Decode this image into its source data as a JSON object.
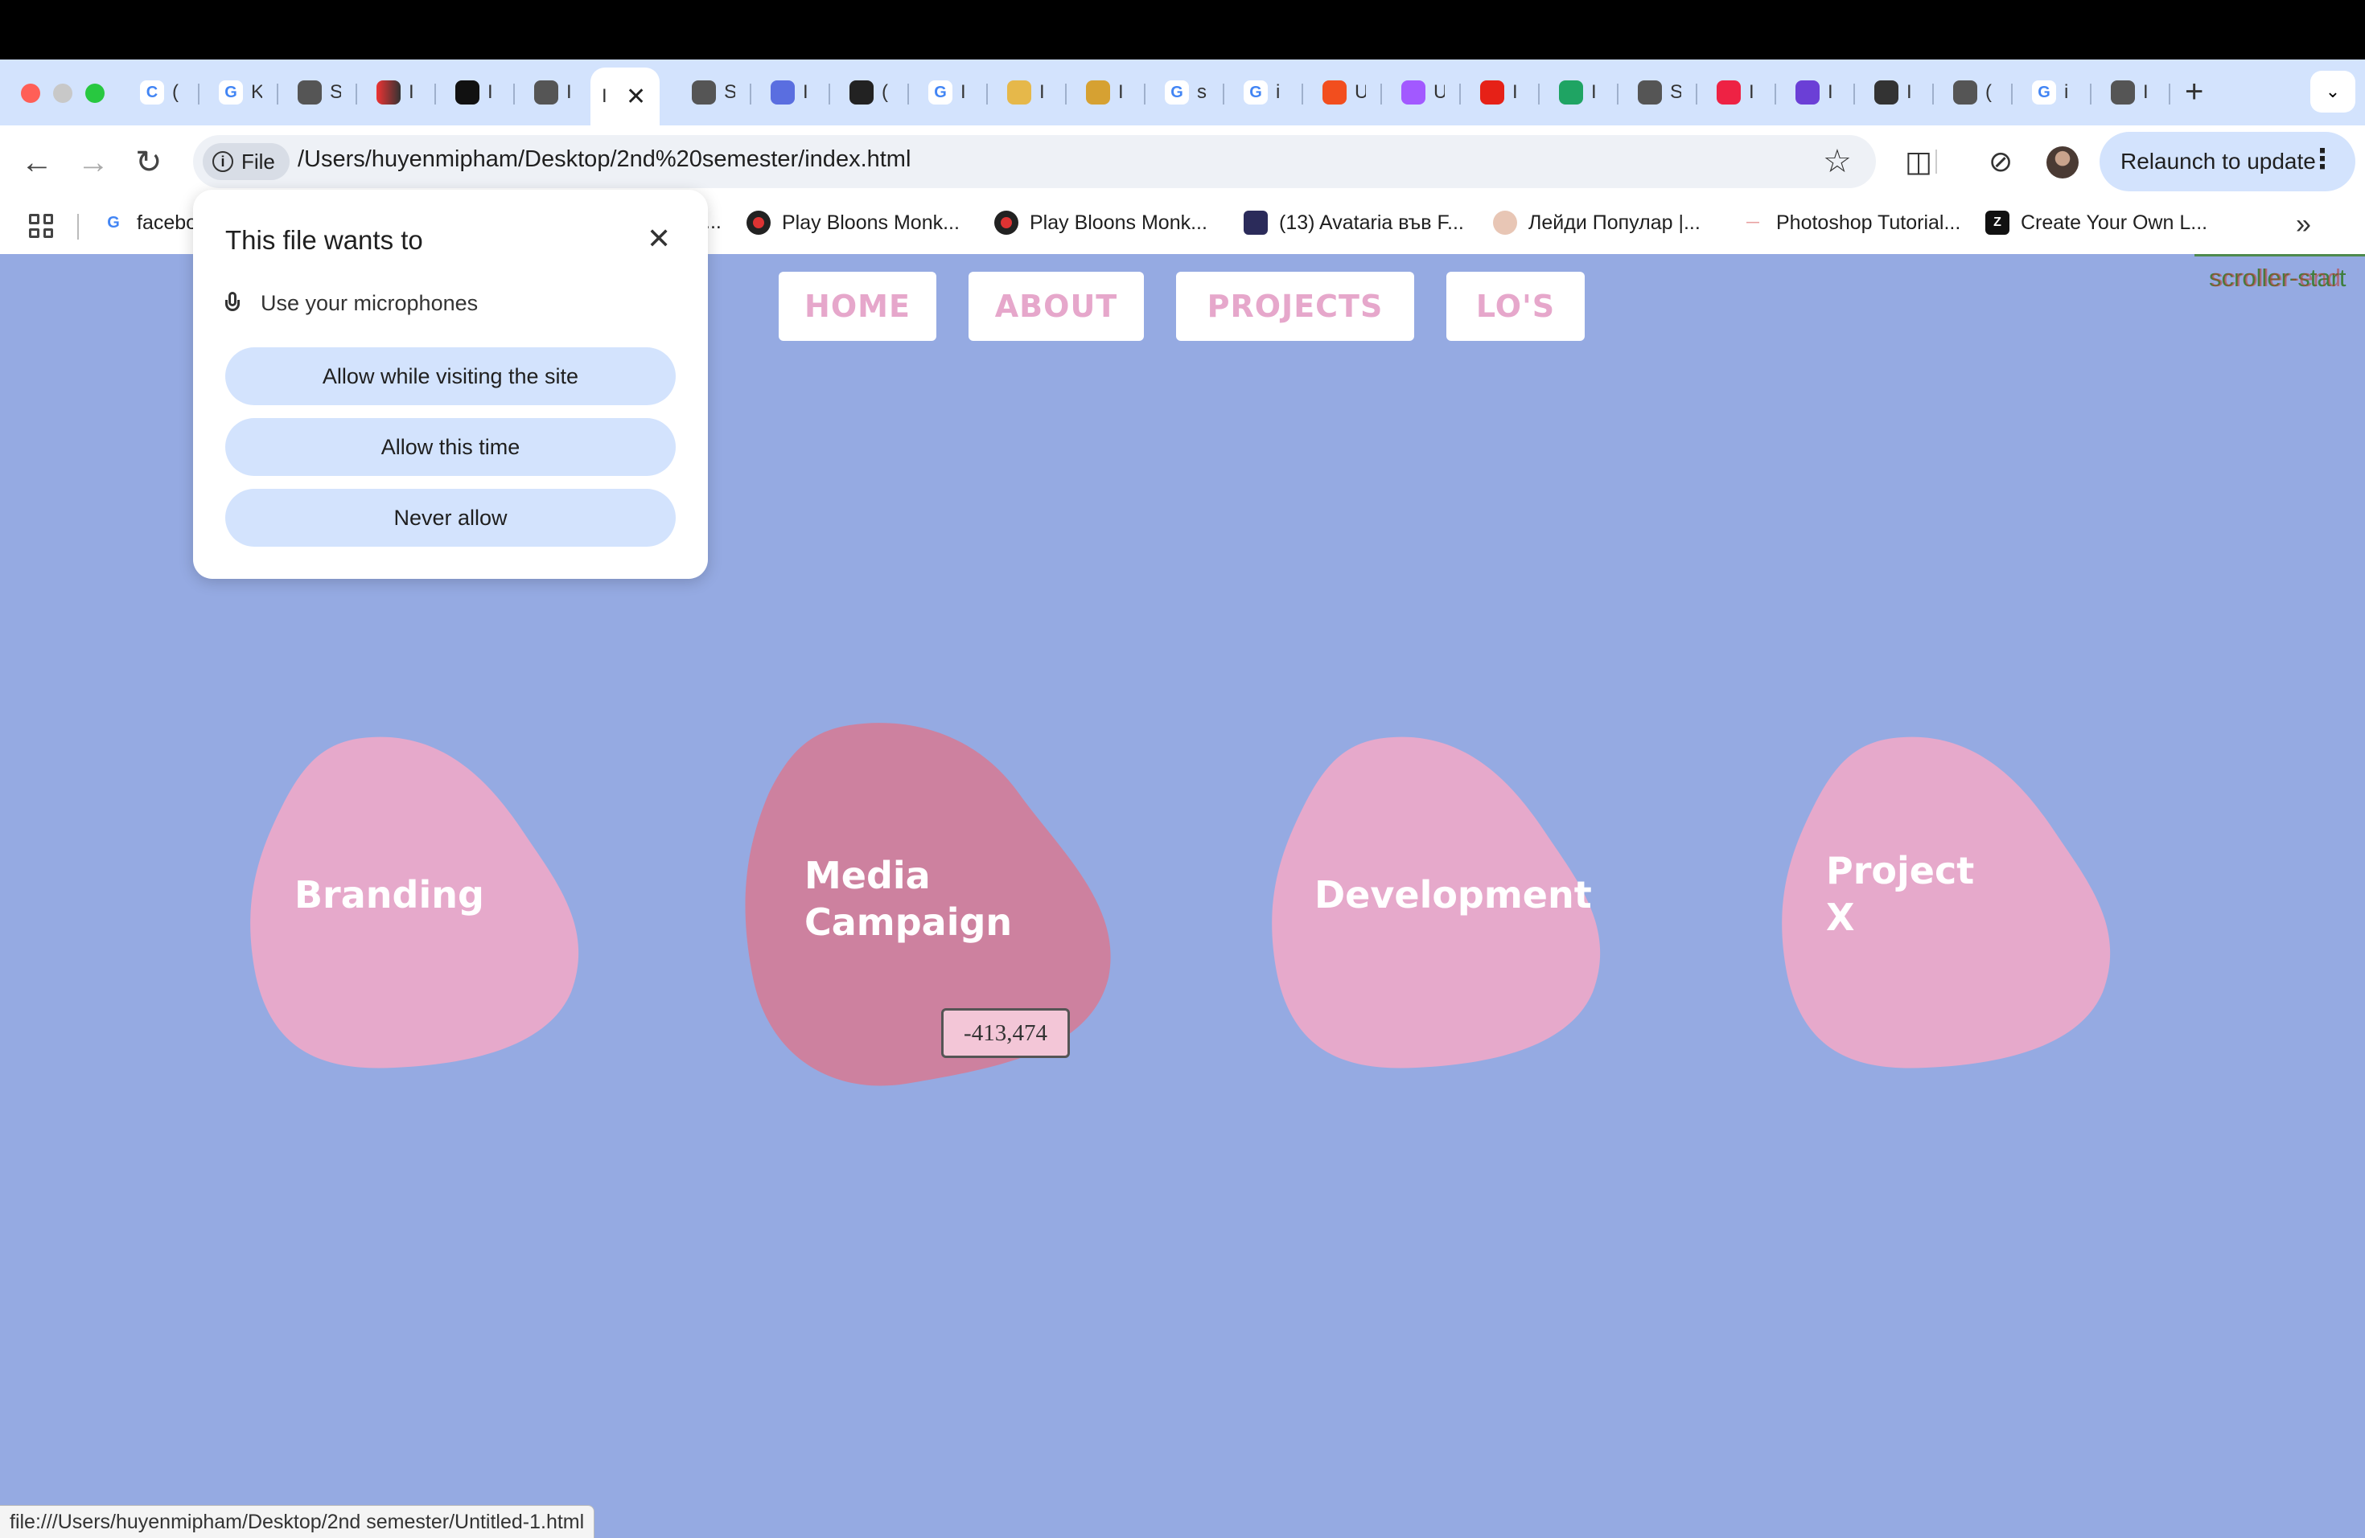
{
  "browser": {
    "active_tab_title": "I",
    "tab_titles": [
      "(",
      "K",
      "S",
      "I",
      "I",
      "I",
      "S",
      "I",
      "(",
      "I",
      "I",
      "I",
      "s",
      "i",
      "U",
      "U",
      "I",
      "I",
      "S",
      "I",
      "I",
      "I",
      "(",
      "i",
      "I"
    ],
    "address": {
      "chip_label": "File",
      "url": "/Users/huyenmipham/Desktop/2nd%20semester/index.html"
    },
    "relaunch_label": "Relaunch to update",
    "bookmarks": [
      {
        "label": "facebo",
        "icon": "google-icon"
      },
      {
        "label": "Play Bloons Monk...",
        "icon": "bloons-icon"
      },
      {
        "label": "Play Bloons Monk...",
        "icon": "bloons-icon"
      },
      {
        "label": "(13) Avataria във F...",
        "icon": "avataria-icon"
      },
      {
        "label": "Лейди Популар |...",
        "icon": "lady-popular-icon"
      },
      {
        "label": "Photoshop Tutorial...",
        "icon": "photoshop-icon"
      },
      {
        "label": "Create Your Own L...",
        "icon": "zipper-icon"
      }
    ],
    "bookmarks_partial": "..."
  },
  "permission_popup": {
    "title": "This file wants to",
    "permission": "Use your microphones",
    "buttons": [
      "Allow while visiting the site",
      "Allow this time",
      "Never allow"
    ]
  },
  "page": {
    "nav": [
      "HOME",
      "ABOUT",
      "PROJECTS",
      "LO'S"
    ],
    "scroller_label": "scroller-start",
    "scroller_label_overlap": "scroller-end",
    "blobs": [
      {
        "label": "Branding",
        "color": "#e6a9cb"
      },
      {
        "label": "Media\nCampaign",
        "color": "#cd819f"
      },
      {
        "label": "Development",
        "color": "#e6a9cb"
      },
      {
        "label": "Project\nX",
        "color": "#e6a9cb"
      }
    ],
    "tooltip_value": "-413,474"
  },
  "status_bar": "file:///Users/huyenmipham/Desktop/2nd semester/Untitled-1.html",
  "colors": {
    "page_background": "#95aae2",
    "nav_text": "#e6a7cb",
    "tabstrip": "#d3e3fd"
  }
}
